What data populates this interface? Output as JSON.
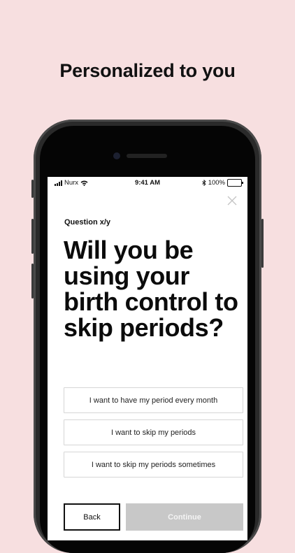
{
  "headline": "Personalized to you",
  "status_bar": {
    "carrier": "Nurx",
    "time": "9:41 AM",
    "battery": "100%"
  },
  "question": {
    "counter": "Question x/y",
    "text": "Will you be using your birth control to skip periods?"
  },
  "options": [
    {
      "label": "I want to have my period every month"
    },
    {
      "label": "I want to skip my periods"
    },
    {
      "label": "I want to skip my periods sometimes"
    }
  ],
  "buttons": {
    "back": "Back",
    "continue": "Continue"
  },
  "icons": [
    "signal-icon",
    "wifi-icon",
    "bluetooth-icon",
    "battery-icon",
    "close-icon"
  ],
  "colors": {
    "background": "#f7dfe0",
    "continue_disabled": "#c8c8c8",
    "text": "#111111"
  }
}
